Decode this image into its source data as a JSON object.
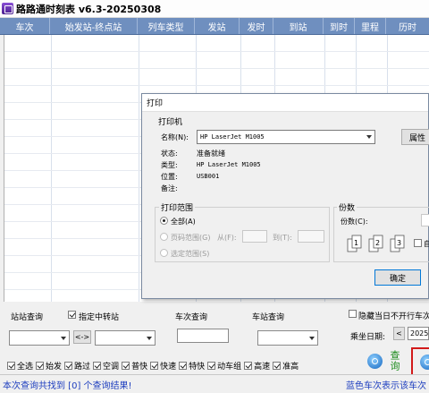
{
  "window": {
    "title": "路路通时刻表 v6.3-20250308"
  },
  "grid": {
    "columns": [
      "车次",
      "始发站-终点站",
      "列车类型",
      "发站",
      "发时",
      "到站",
      "到时",
      "里程",
      "历时"
    ]
  },
  "print_dialog": {
    "title": "打印",
    "printer_section": "打印机",
    "name_label": "名称(N):",
    "printer_name": "HP LaserJet M1005",
    "properties_button": "属性",
    "status_label": "状态:",
    "status_value": "准备就绪",
    "type_label": "类型:",
    "type_value": "HP LaserJet M1005",
    "location_label": "位置:",
    "location_value": "USB001",
    "comment_label": "备注:",
    "range_section": "打印范围",
    "range_all": "全部(A)",
    "range_pages": "页码范围(G)",
    "from_label": "从(F):",
    "to_label": "到(T):",
    "range_selection": "选定范围(S)",
    "copies_section": "份数",
    "copies_label": "份数(C):",
    "collate_label": "自",
    "ok_button": "确定"
  },
  "query": {
    "station_query_label": "站站查询",
    "via_station_label": "指定中转站",
    "swap_button": "<->",
    "train_query_label": "车次查询",
    "station_stop_label": "车站查询",
    "hide_not_running_label": "隐藏当日不开行车次",
    "date_label": "乘坐日期:",
    "date_value": "2025-",
    "date_prev": "<",
    "query_button": "查询"
  },
  "filters": [
    {
      "label": "全选",
      "checked": true
    },
    {
      "label": "始发",
      "checked": true
    },
    {
      "label": "路过",
      "checked": true
    },
    {
      "label": "空调",
      "checked": true
    },
    {
      "label": "普快",
      "checked": true
    },
    {
      "label": "快速",
      "checked": true
    },
    {
      "label": "特快",
      "checked": true
    },
    {
      "label": "动车组",
      "checked": true
    },
    {
      "label": "高速",
      "checked": true
    },
    {
      "label": "准高",
      "checked": true
    }
  ],
  "status": {
    "left": "本次查询共找到 [0] 个查询结果!",
    "right": "蓝色车次表示该车次",
    "left_color": "#1f3fbf",
    "right_color": "#1f3fbf"
  }
}
